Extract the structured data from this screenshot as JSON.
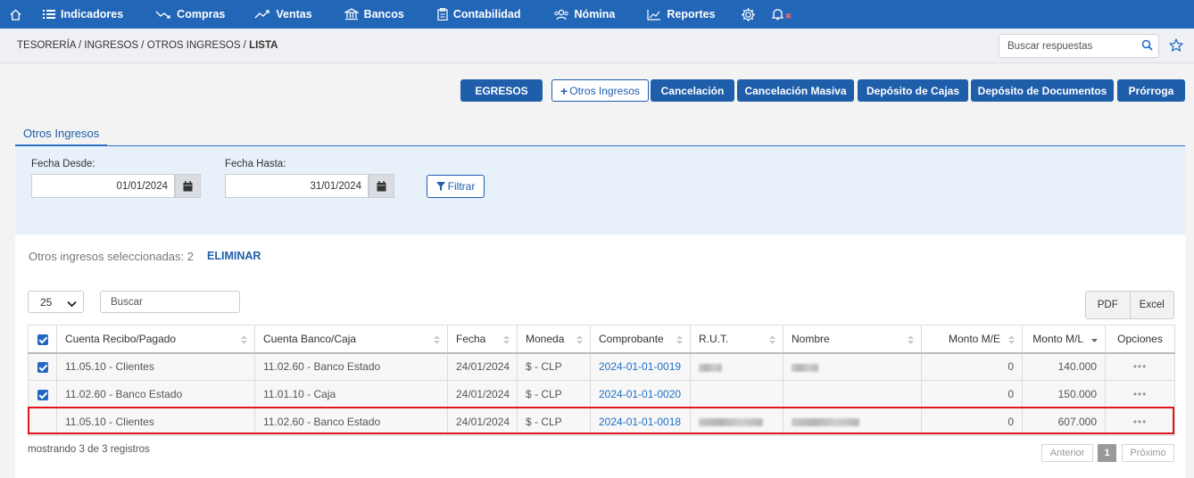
{
  "nav": {
    "items": [
      {
        "label": "Indicadores",
        "icon": "list-icon"
      },
      {
        "label": "Compras",
        "icon": "chart-down-icon"
      },
      {
        "label": "Ventas",
        "icon": "chart-up-icon"
      },
      {
        "label": "Bancos",
        "icon": "bank-icon"
      },
      {
        "label": "Contabilidad",
        "icon": "clipboard-icon"
      },
      {
        "label": "Nómina",
        "icon": "users-icon"
      },
      {
        "label": "Reportes",
        "icon": "line-chart-icon"
      }
    ]
  },
  "breadcrumb": {
    "path": "TESORERÍA / INGRESOS / OTROS INGRESOS / ",
    "current": "LISTA"
  },
  "search": {
    "placeholder": "Buscar respuestas"
  },
  "actions": {
    "egresos": "EGRESOS",
    "otros_ingresos": "Otros Ingresos",
    "cancelacion": "Cancelación",
    "cancelacion_masiva": "Cancelación Masiva",
    "deposito_cajas": "Depósito de Cajas",
    "deposito_documentos": "Depósito de Documentos",
    "prorroga": "Prórroga"
  },
  "tab": {
    "label": "Otros Ingresos"
  },
  "filter": {
    "desde_label": "Fecha Desde:",
    "desde_value": "01/01/2024",
    "hasta_label": "Fecha Hasta:",
    "hasta_value": "31/01/2024",
    "button": "Filtrar"
  },
  "selection": {
    "text": "Otros ingresos seleccionadas: 2",
    "delete": "ELIMINAR"
  },
  "table_controls": {
    "page_size": "25",
    "search_placeholder": "Buscar",
    "pdf": "PDF",
    "excel": "Excel"
  },
  "table": {
    "headers": {
      "cuenta_recibo": "Cuenta Recibo/Pagado",
      "cuenta_banco": "Cuenta Banco/Caja",
      "fecha": "Fecha",
      "moneda": "Moneda",
      "comprobante": "Comprobante",
      "rut": "R.U.T.",
      "nombre": "Nombre",
      "monto_me": "Monto M/E",
      "monto_ml": "Monto M/L",
      "opciones": "Opciones"
    },
    "rows": [
      {
        "checked": true,
        "cuenta_recibo": "11.05.10 - Clientes",
        "cuenta_banco": "11.02.60 - Banco Estado",
        "fecha": "24/01/2024",
        "moneda": "$ - CLP",
        "comprobante": "2024-01-01-0019",
        "monto_me": "0",
        "monto_ml": "140.000",
        "opciones": "•••"
      },
      {
        "checked": true,
        "cuenta_recibo": "11.02.60 - Banco Estado",
        "cuenta_banco": "11.01.10 - Caja",
        "fecha": "24/01/2024",
        "moneda": "$ - CLP",
        "comprobante": "2024-01-01-0020",
        "monto_me": "0",
        "monto_ml": "150.000",
        "opciones": "•••"
      },
      {
        "checked": false,
        "cuenta_recibo": "11.05.10 - Clientes",
        "cuenta_banco": "11.02.60 - Banco Estado",
        "fecha": "24/01/2024",
        "moneda": "$ - CLP",
        "comprobante": "2024-01-01-0018",
        "monto_me": "0",
        "monto_ml": "607.000",
        "opciones": "•••"
      }
    ]
  },
  "footer": {
    "showing": "mostrando 3 de 3 registros",
    "prev": "Anterior",
    "page": "1",
    "next": "Próximo"
  },
  "colors": {
    "nav_bg": "#2266b8",
    "primary": "#1f5eab",
    "highlight": "#e3141c"
  }
}
